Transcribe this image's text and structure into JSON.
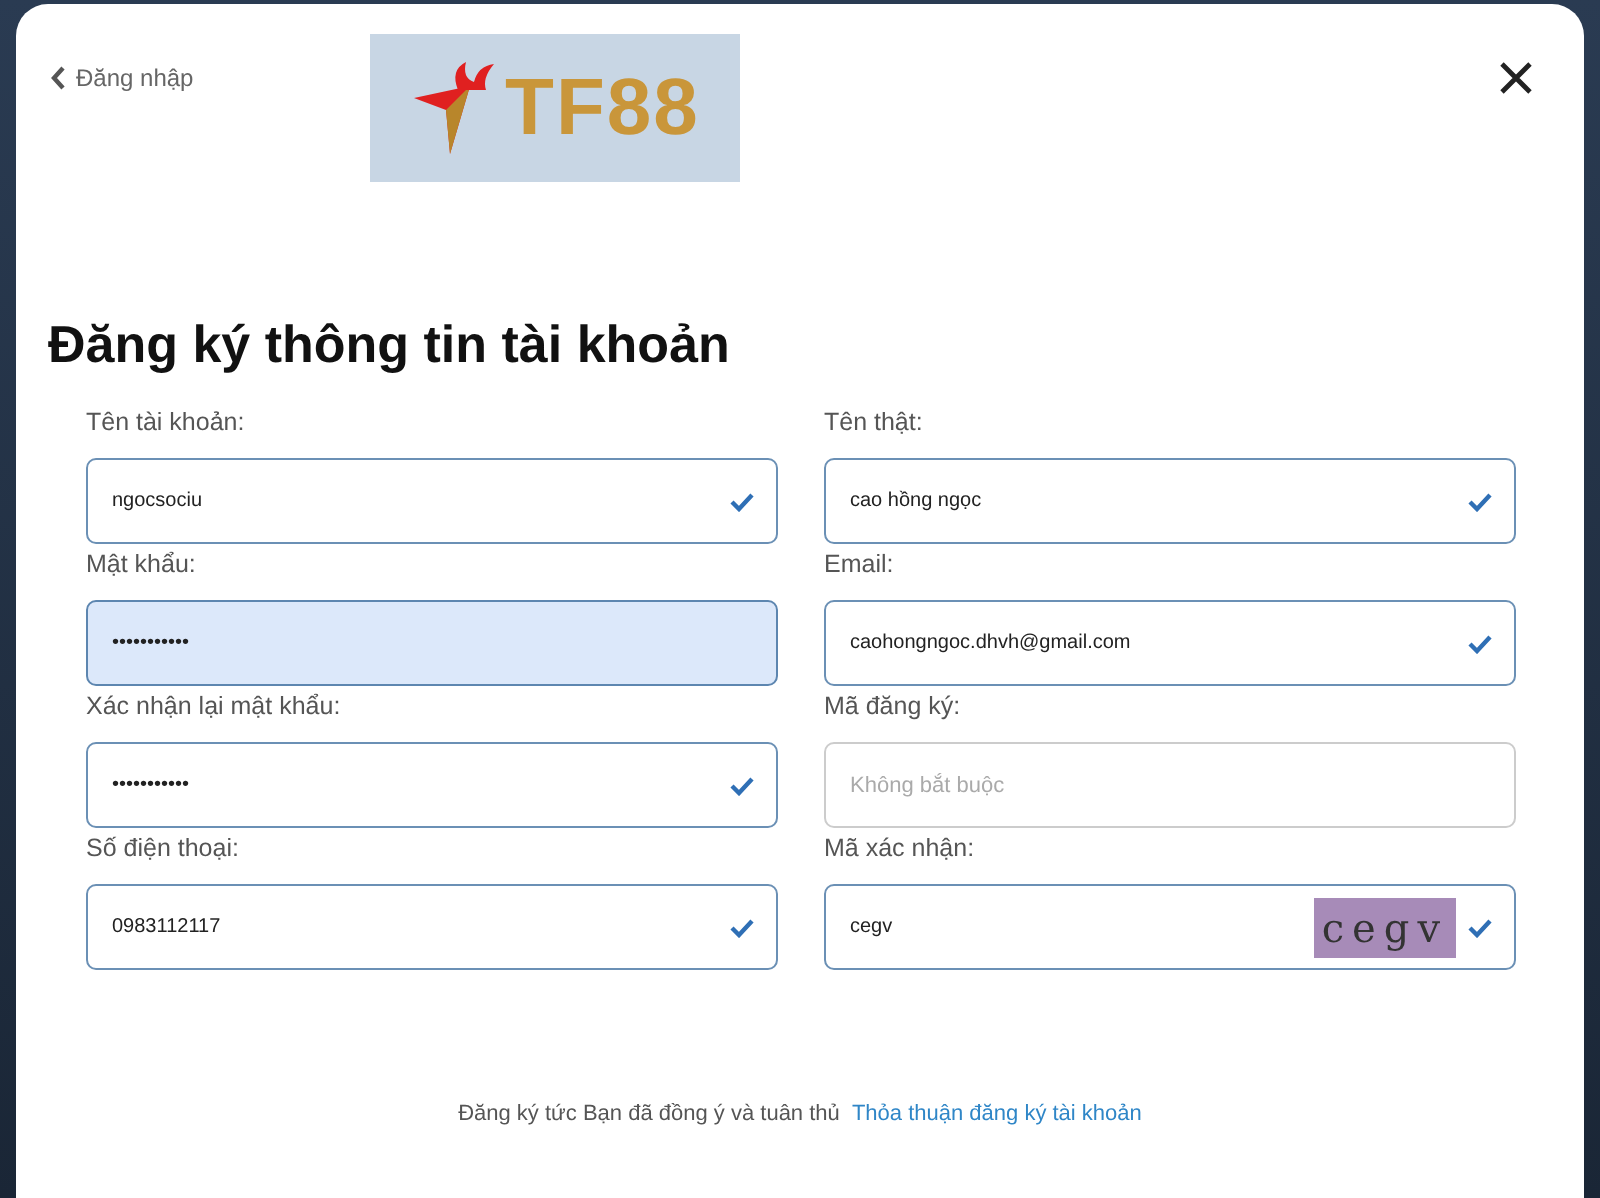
{
  "back_link": {
    "label": "Đăng nhập"
  },
  "logo": {
    "text": "TF88"
  },
  "title": "Đăng ký thông tin tài khoản",
  "fields": [
    {
      "label": "Tên tài khoản:",
      "value": "ngocsociu",
      "valid": true,
      "autofilled": false
    },
    {
      "label": "Tên thật:",
      "value": "cao hồng ngọc",
      "valid": true,
      "autofilled": false
    },
    {
      "label": "Mật khẩu:",
      "value": "•••••••••••",
      "valid": false,
      "autofilled": true
    },
    {
      "label": "Email:",
      "value": "caohongngoc.dhvh@gmail.com",
      "valid": true,
      "autofilled": false
    },
    {
      "label": "Xác nhận lại mật khẩu:",
      "value": "•••••••••••",
      "valid": true,
      "autofilled": false
    },
    {
      "label": "Mã đăng ký:",
      "placeholder": "Không bắt buộc",
      "valid": false,
      "autofilled": false
    },
    {
      "label": "Số điện thoại:",
      "value": "0983112117",
      "valid": true,
      "autofilled": false
    },
    {
      "label": "Mã xác nhận:",
      "value": "cegv",
      "captcha": "cegv",
      "valid": true,
      "autofilled": false
    }
  ],
  "footer": {
    "text": "Đăng ký tức Bạn đã đồng ý và tuân thủ",
    "link": "Thỏa thuận đăng ký tài khoản"
  }
}
